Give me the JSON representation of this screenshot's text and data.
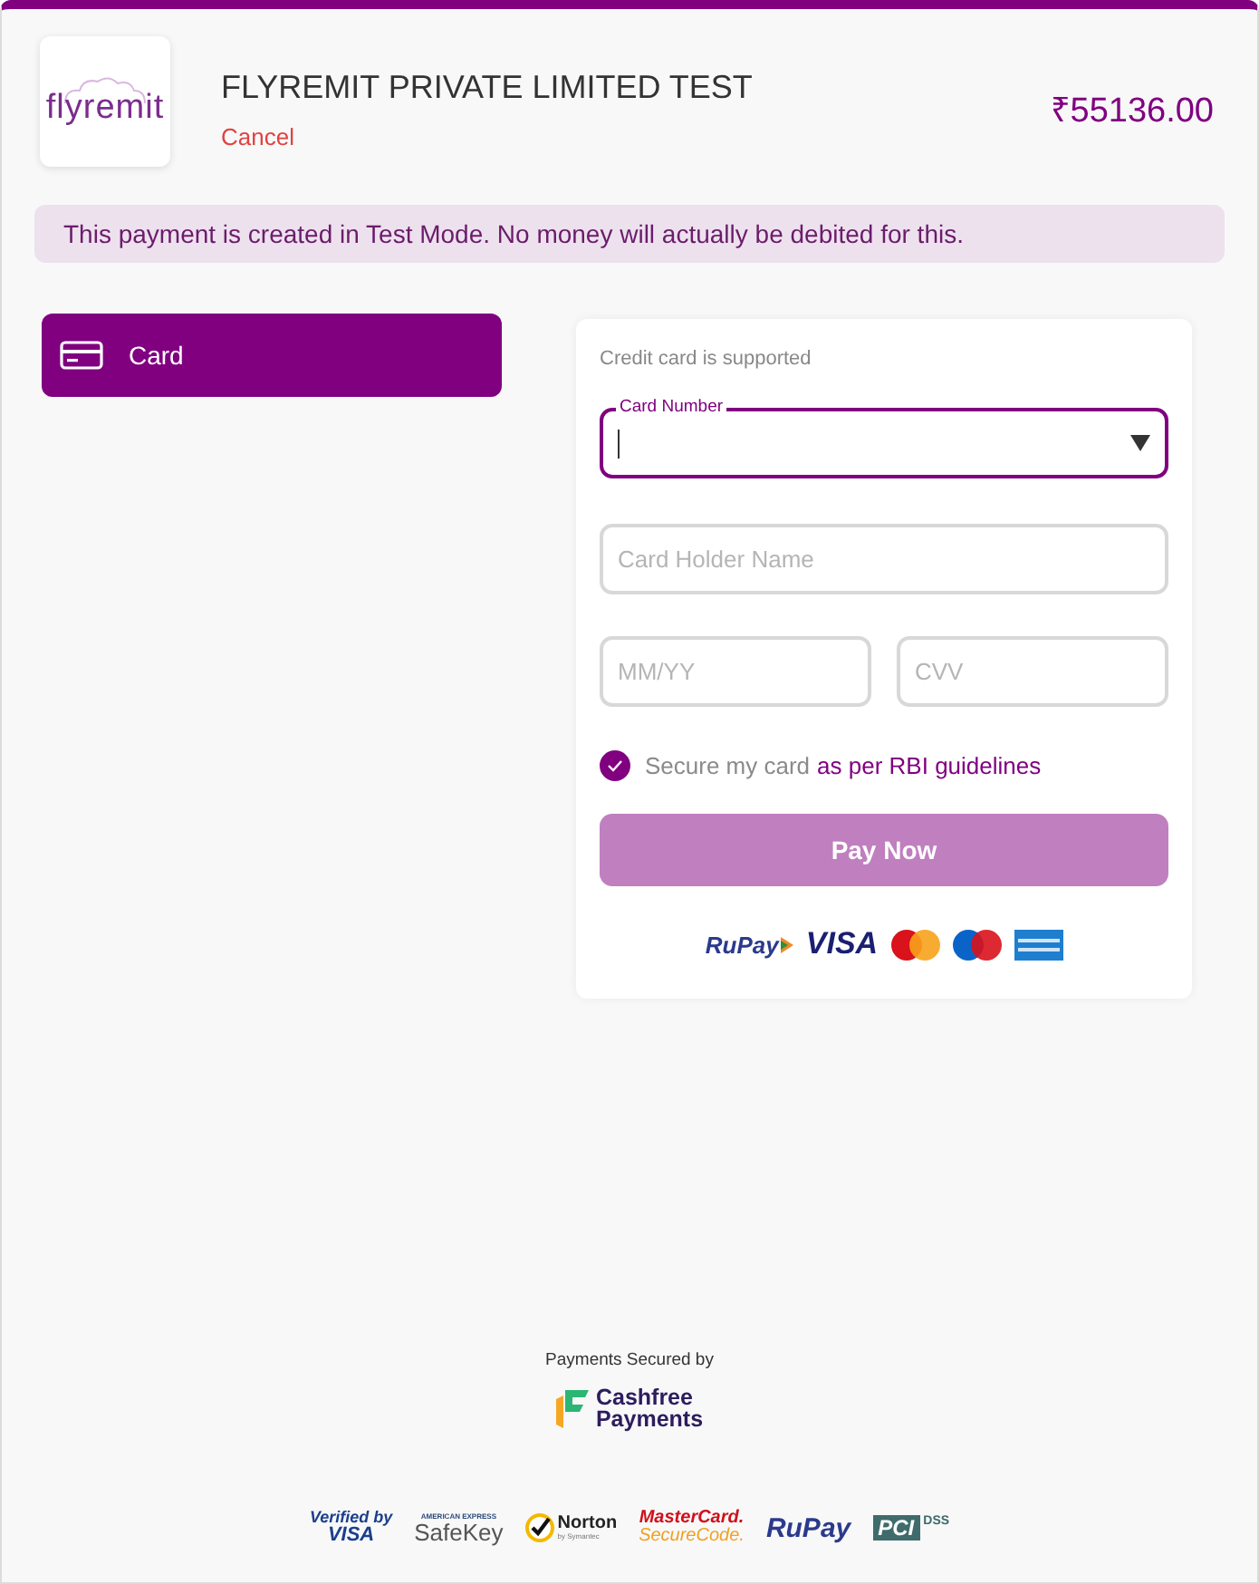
{
  "header": {
    "logo": "flyremit",
    "merchant": "FLYREMIT PRIVATE LIMITED TEST",
    "cancel": "Cancel",
    "amount": "₹55136.00"
  },
  "notice": "This payment is created in Test Mode. No money will actually be debited for this.",
  "methods": [
    {
      "label": "Card",
      "selected": true
    }
  ],
  "form": {
    "note": "Credit card is supported",
    "card_number": {
      "label": "Card Number",
      "focused": true
    },
    "holder": {
      "placeholder": "Card Holder Name"
    },
    "expiry": {
      "placeholder": "MM/YY"
    },
    "cvv": {
      "placeholder": "CVV"
    },
    "save_card": {
      "label": "Secure my card",
      "link": "as per RBI guidelines",
      "checked": true
    },
    "pay_button": {
      "label": "Pay Now",
      "disabled": true
    },
    "card_brands": [
      {
        "kind": "rupay",
        "text": "RuPay"
      },
      {
        "kind": "visa",
        "text": "VISA"
      },
      {
        "kind": "mastercard"
      },
      {
        "kind": "maestro"
      },
      {
        "kind": "amex"
      }
    ]
  },
  "footer": {
    "secured_by": "Payments Secured by",
    "provider": [
      "Cashfree",
      "Payments"
    ],
    "badges": [
      {
        "kind": "verified_visa",
        "lines": [
          "Verified by",
          "VISA"
        ]
      },
      {
        "kind": "safekey",
        "lines": [
          "AMERICAN EXPRESS",
          "SafeKey"
        ]
      },
      {
        "kind": "norton",
        "lines": [
          "Norton",
          "by Symantec"
        ]
      },
      {
        "kind": "securecode",
        "lines": [
          "MasterCard.",
          "SecureCode."
        ]
      },
      {
        "kind": "rupay",
        "lines": [
          "RuPay"
        ]
      },
      {
        "kind": "pci",
        "lines": [
          "PCI",
          "DSS"
        ]
      }
    ]
  }
}
